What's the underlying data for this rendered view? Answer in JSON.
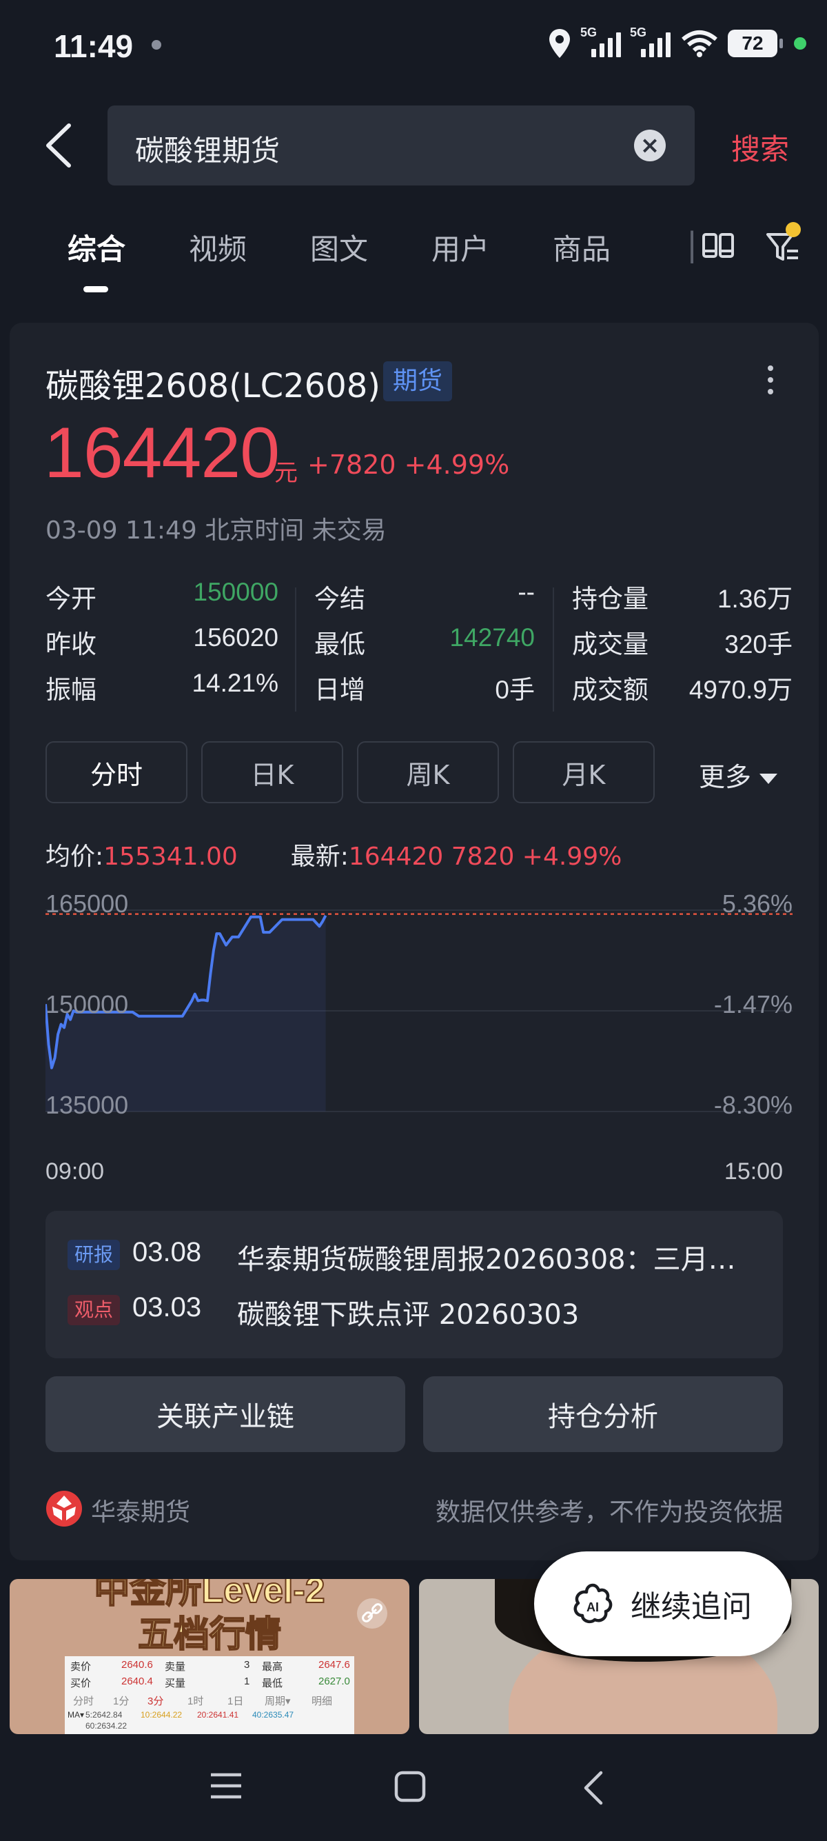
{
  "status_bar": {
    "time": "11:49",
    "battery": "72",
    "signal1": "5G",
    "signal2": "5G"
  },
  "search": {
    "query": "碳酸锂期货",
    "button": "搜索"
  },
  "tabs": [
    "综合",
    "视频",
    "图文",
    "用户",
    "商品"
  ],
  "tabs_active_index": 0,
  "quote": {
    "title": "碳酸锂2608(LC2608)",
    "badge": "期货",
    "price": "164420",
    "unit": "元",
    "change": "+7820 +4.99%",
    "time_info": "03-09 11:49 北京时间 未交易"
  },
  "stats": {
    "col1": [
      {
        "label": "今开",
        "value": "150000"
      },
      {
        "label": "昨收",
        "value": "156020"
      },
      {
        "label": "振幅",
        "value": "14.21%"
      }
    ],
    "col2": [
      {
        "label": "今结",
        "value": "--"
      },
      {
        "label": "最低",
        "value": "142740"
      },
      {
        "label": "日增",
        "value": "0手"
      }
    ],
    "col3": [
      {
        "label": "持仓量",
        "value": "1.36万"
      },
      {
        "label": "成交量",
        "value": "320手"
      },
      {
        "label": "成交额",
        "value": "4970.9万"
      }
    ]
  },
  "k_tabs": [
    "分时",
    "日K",
    "周K",
    "月K"
  ],
  "k_more": "更多",
  "avg": {
    "label": "均价:",
    "value": "155341.00",
    "latest_label": "最新:",
    "latest_value": "164420 7820 +4.99%"
  },
  "chart_data": {
    "type": "line",
    "y_ticks_left": [
      "165000",
      "150000",
      "135000"
    ],
    "y_ticks_right": [
      "5.36%",
      "-1.47%",
      "-8.30%"
    ],
    "x_ticks": [
      "09:00",
      "15:00"
    ],
    "ylim": [
      135000,
      165000
    ],
    "reference_line": 164420,
    "series": [
      {
        "x": [
          0,
          1,
          2,
          3,
          4,
          5,
          6,
          7,
          8,
          9,
          10,
          12,
          14,
          16,
          18,
          20,
          24,
          28,
          30,
          32,
          36,
          40,
          44,
          47,
          48,
          49,
          50,
          51,
          52,
          53,
          54,
          55,
          56,
          58,
          60,
          62,
          64,
          66,
          67,
          68,
          69,
          70,
          72,
          76,
          80,
          84,
          86,
          88,
          89,
          90
        ],
        "values": [
          151000,
          145000,
          141500,
          143000,
          146500,
          148000,
          147500,
          149500,
          148700,
          150000,
          149800,
          149800,
          149800,
          149800,
          149800,
          149800,
          149800,
          149800,
          149200,
          149200,
          149200,
          149200,
          149200,
          151500,
          152500,
          151500,
          151600,
          151600,
          151500,
          155500,
          159000,
          161500,
          161500,
          159800,
          161000,
          161000,
          162500,
          164000,
          164000,
          164000,
          164000,
          161700,
          161700,
          163600,
          163600,
          163600,
          163600,
          162600,
          163300,
          164200
        ]
      }
    ]
  },
  "news": [
    {
      "tag": "研报",
      "date": "03.08",
      "text": "华泰期货碳酸锂周报20260308：三月…"
    },
    {
      "tag": "观点",
      "date": "03.03",
      "text": "碳酸锂下跌点评 20260303"
    }
  ],
  "actions": [
    "关联产业链",
    "持仓分析"
  ],
  "footer": {
    "brand": "华泰期货",
    "disclaimer": "数据仅供参考，不作为投资依据"
  },
  "thumb1": {
    "title1": "中金所Level-2",
    "title2": "五档行情",
    "sell_label": "卖价",
    "sell_val": "2640.6",
    "sell_qty_label": "卖量",
    "sell_qty": "3",
    "high_label": "最高",
    "high_val": "2647.6",
    "buy_label": "买价",
    "buy_val": "2640.4",
    "buy_qty_label": "买量",
    "buy_qty": "1",
    "low_label": "最低",
    "low_val": "2627.0",
    "tabs": [
      "分时",
      "1分",
      "3分",
      "1时",
      "1日",
      "周期▾",
      "明细"
    ],
    "ma_label": "MA▾",
    "ma_values": [
      "5:2642.84",
      "10:2644.22",
      "20:2641.41",
      "40:2635.47"
    ],
    "ma_extra": "60:2634.22"
  },
  "ai_button": "继续追问"
}
